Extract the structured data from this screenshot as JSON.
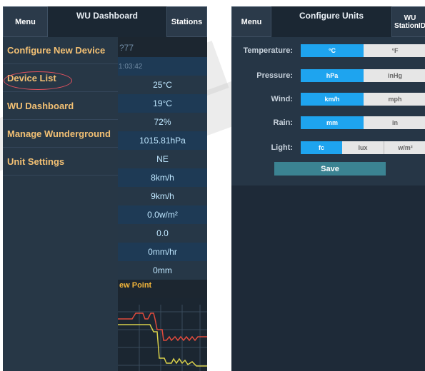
{
  "left_app": {
    "menu_label": "Menu",
    "title": "WU Dashboard",
    "stations_label": "Stations",
    "drawer_items": [
      {
        "label": "Configure New Device"
      },
      {
        "label": "Device List"
      },
      {
        "label": "WU Dashboard"
      },
      {
        "label": "Manage Wunderground"
      },
      {
        "label": "Unit Settings"
      }
    ],
    "dashboard_values": [
      "?77",
      "1:03:42",
      "25°C",
      "19°C",
      "72%",
      "1015.81hPa",
      "NE",
      "8km/h",
      "9km/h",
      "0.0w/m²",
      "0.0",
      "0mm/hr",
      "0mm"
    ],
    "chart_label": "ew Point",
    "colors": {
      "drawer_text": "#f2c074",
      "highlight_circle": "#e6525f"
    }
  },
  "right_app": {
    "menu_label": "Menu",
    "title": "Configure Units",
    "station_label_line1": "WU",
    "station_label_line2": "StationID",
    "units": [
      {
        "label": "Temperature:",
        "options": [
          "°C",
          "°F"
        ],
        "selected": 0
      },
      {
        "label": "Pressure:",
        "options": [
          "hPa",
          "inHg"
        ],
        "selected": 0
      },
      {
        "label": "Wind:",
        "options": [
          "km/h",
          "mph"
        ],
        "selected": 0
      },
      {
        "label": "Rain:",
        "options": [
          "mm",
          "in"
        ],
        "selected": 0
      },
      {
        "label": "Light:",
        "options": [
          "fc",
          "lux",
          "w/m²"
        ],
        "selected": 0
      }
    ],
    "save_label": "Save",
    "colors": {
      "selected": "#1ea4ef",
      "save": "#3b8392"
    }
  }
}
